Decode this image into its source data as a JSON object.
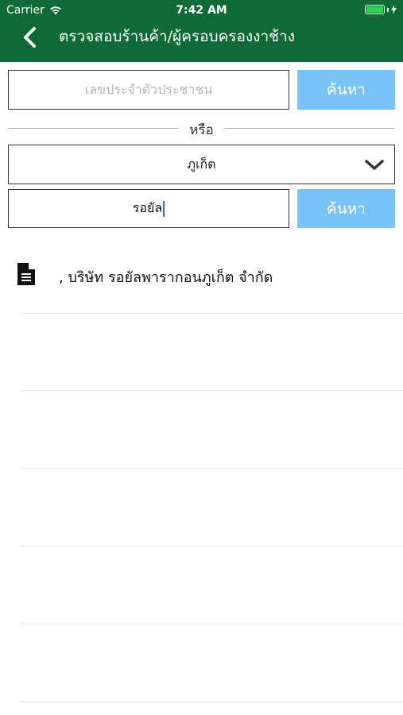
{
  "status_bar": {
    "carrier": "Carrier",
    "time": "7:42 AM"
  },
  "header": {
    "title": "ตรวจสอบร้านค้า/ผู้ครอบครองงาช้าง",
    "back_icon": "chevron-left-icon",
    "background_color": "#0e6a36"
  },
  "form": {
    "id_input_placeholder": "เลขประจำตัวประชาชน",
    "id_input_value": "",
    "search_button_1_label": "ค้นหา",
    "divider_label": "หรือ",
    "province_selected": "ภูเก็ต",
    "name_input_value": "รอยัล",
    "search_button_2_label": "ค้นหา",
    "button_color": "#78c3fa"
  },
  "results": {
    "items": [
      {
        "icon": "document-icon",
        "label": ", บริษัท รอยัลพารากอนภูเก็ต จำกัด"
      }
    ]
  }
}
